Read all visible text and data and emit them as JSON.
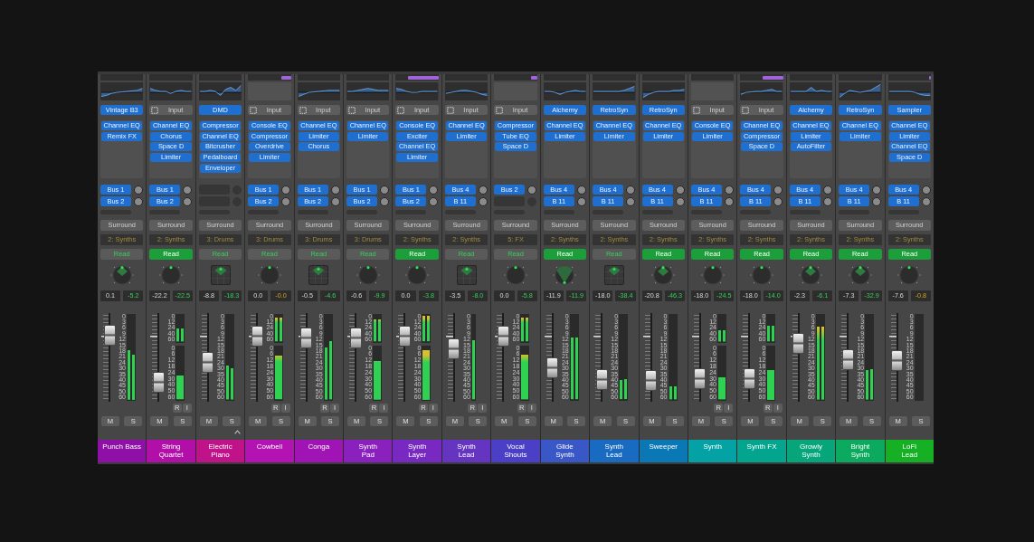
{
  "mixer": {
    "strips": [
      {
        "name": "Punch Bass",
        "color": "#8e10a6",
        "eq": {
          "kind": "curve"
        },
        "input": {
          "kind": "instrument",
          "label": "Vintage B3"
        },
        "plugins": [
          "Channel EQ",
          "Remix FX"
        ],
        "sends": [
          "Bus 1",
          "Bus 2"
        ],
        "output": "Surround",
        "group": "2: Synths",
        "automation": {
          "label": "Read",
          "active": false
        },
        "pan": {
          "kind": "wedge"
        },
        "volume": "0.1",
        "peak": {
          "text": "-5.2",
          "near_clip": false
        },
        "fader": {
          "level": 0.74
        },
        "meter": {
          "kind": "single",
          "scale": [
            "0",
            "3",
            "6",
            "9",
            "12",
            "15",
            "18",
            "21",
            "24",
            "30",
            "35",
            "40",
            "45",
            "50",
            "60"
          ],
          "bars": [
            {
              "level": 0.57
            },
            {
              "level": 0.52
            }
          ]
        },
        "mute": "M",
        "solo": "S",
        "caret": false
      },
      {
        "name": "String\nQuartet",
        "color": "#b10fa8",
        "eq": {
          "kind": "curve"
        },
        "input": {
          "kind": "input",
          "label": "Input"
        },
        "plugins": [
          "Channel EQ",
          "Chorus",
          "Space D",
          "Limiter"
        ],
        "sends": [
          "Bus 1",
          "Bus 2"
        ],
        "output": "Surround",
        "group": "2: Synths",
        "automation": {
          "label": "Read",
          "active": true
        },
        "pan": {
          "kind": "knob"
        },
        "volume": "-22.2",
        "peak": {
          "text": "-22.5",
          "near_clip": false
        },
        "fader": {
          "level": 0.21
        },
        "meter": {
          "kind": "split",
          "input_scale": [
            "0",
            "12",
            "24",
            "40",
            "60"
          ],
          "input_bars": [
            {
              "level": 0.45
            },
            {
              "level": 0.45
            }
          ],
          "scale": [
            "0",
            "6",
            "12",
            "18",
            "24",
            "30",
            "40",
            "50",
            "60"
          ],
          "bars": [
            {
              "level": 0.43
            }
          ]
        },
        "rec_buttons": [
          "R",
          "I"
        ],
        "mute": "M",
        "solo": "S",
        "caret": false
      },
      {
        "name": "Electric\nPiano",
        "color": "#c0138a",
        "eq": {
          "kind": "curve"
        },
        "input": {
          "kind": "instrument",
          "label": "DMD"
        },
        "plugins": [
          "Compressor",
          "Channel EQ",
          "Bitcrusher",
          "Pedalboard",
          "Enveloper"
        ],
        "output": "Surround",
        "group": "3: Drums",
        "automation": {
          "label": "Read",
          "active": false
        },
        "pan": {
          "kind": "square"
        },
        "volume": "-8.8",
        "peak": {
          "text": "-18.3",
          "near_clip": false
        },
        "fader": {
          "level": 0.44
        },
        "meter": {
          "kind": "single",
          "scale": [
            "0",
            "3",
            "6",
            "9",
            "12",
            "15",
            "18",
            "21",
            "24",
            "30",
            "35",
            "40",
            "45",
            "50",
            "60"
          ],
          "bars": [
            {
              "level": 0.39
            },
            {
              "level": 0.36
            }
          ]
        },
        "mute": "M",
        "solo": "S",
        "caret": true
      },
      {
        "name": "Cowbell",
        "color": "#b313b2",
        "top_bar": {
          "level": 0.22
        },
        "eq": {
          "kind": "empty"
        },
        "input": {
          "kind": "input",
          "label": "Input"
        },
        "plugins": [
          "Console EQ",
          "Compressor",
          "Overdrive",
          "Limiter"
        ],
        "sends": [
          "Bus 1",
          "Bus 2"
        ],
        "output": "Surround",
        "group": "3: Drums",
        "automation": {
          "label": "Read",
          "active": false
        },
        "pan": {
          "kind": "knob"
        },
        "volume": "0.0",
        "peak": {
          "text": "-0.0",
          "near_clip": true
        },
        "fader": {
          "level": 0.73
        },
        "meter": {
          "kind": "split",
          "input_scale": [
            "0",
            "12",
            "24",
            "40",
            "60"
          ],
          "input_bars": [
            {
              "level": 0.82
            },
            {
              "level": 0.82
            }
          ],
          "scale": [
            "0",
            "6",
            "12",
            "18",
            "24",
            "30",
            "40",
            "50",
            "60"
          ],
          "bars": [
            {
              "level": 0.79
            }
          ]
        },
        "rec_buttons": [
          "R",
          "I"
        ],
        "mute": "M",
        "solo": "S",
        "caret": false
      },
      {
        "name": "Conga",
        "color": "#a013b5",
        "eq": {
          "kind": "curve"
        },
        "input": {
          "kind": "input",
          "label": "Input"
        },
        "plugins": [
          "Channel EQ",
          "Limiter",
          "Chorus"
        ],
        "sends": [
          "Bus 1",
          "Bus 2"
        ],
        "output": "Surround",
        "group": "3: Drums",
        "automation": {
          "label": "Read",
          "active": false
        },
        "pan": {
          "kind": "square"
        },
        "volume": "-0.5",
        "peak": {
          "text": "-4.6",
          "near_clip": false
        },
        "fader": {
          "level": 0.71
        },
        "meter": {
          "kind": "single",
          "scale": [
            "0",
            "3",
            "6",
            "9",
            "12",
            "15",
            "18",
            "21",
            "24",
            "30",
            "35",
            "40",
            "45",
            "50",
            "60"
          ],
          "bars": [
            {
              "level": 0.6
            },
            {
              "level": 0.67
            }
          ]
        },
        "rec_buttons": [
          "R",
          "I"
        ],
        "mute": "M",
        "solo": "S",
        "caret": false
      },
      {
        "name": "Synth\nPad",
        "color": "#8a20be",
        "eq": {
          "kind": "curve"
        },
        "input": {
          "kind": "input",
          "label": "Input"
        },
        "plugins": [
          "Channel EQ",
          "Limiter"
        ],
        "sends": [
          "Bus 1",
          "Bus 2"
        ],
        "output": "Surround",
        "group": "3: Drums",
        "automation": {
          "label": "Read",
          "active": false
        },
        "pan": {
          "kind": "knob"
        },
        "volume": "-0.6",
        "peak": {
          "text": "-9.9",
          "near_clip": false
        },
        "fader": {
          "level": 0.71
        },
        "meter": {
          "kind": "split",
          "input_scale": [
            "0",
            "12",
            "24",
            "40",
            "60"
          ],
          "input_bars": [
            {
              "level": 0.76
            },
            {
              "level": 0.76
            }
          ],
          "scale": [
            "0",
            "6",
            "12",
            "18",
            "24",
            "30",
            "40",
            "50",
            "60"
          ],
          "bars": [
            {
              "level": 0.7
            }
          ]
        },
        "rec_buttons": [
          "R",
          "I"
        ],
        "mute": "M",
        "solo": "S",
        "caret": false
      },
      {
        "name": "Synth\nLayer",
        "color": "#7829c2",
        "top_bar": {
          "level": 0.72
        },
        "eq": {
          "kind": "curve"
        },
        "input": {
          "kind": "input",
          "label": "Input"
        },
        "plugins": [
          "Console EQ",
          "Exciter",
          "Channel EQ",
          "Limiter"
        ],
        "sends": [
          "Bus 1",
          "Bus 2"
        ],
        "output": "Surround",
        "group": "2: Synths",
        "automation": {
          "label": "Read",
          "active": true
        },
        "pan": {
          "kind": "knob"
        },
        "volume": "0.0",
        "peak": {
          "text": "-3.8",
          "near_clip": false
        },
        "fader": {
          "level": 0.73
        },
        "meter": {
          "kind": "split",
          "input_scale": [
            "0",
            "12",
            "24",
            "40",
            "60"
          ],
          "input_bars": [
            {
              "level": 0.88
            },
            {
              "level": 0.88
            }
          ],
          "scale": [
            "0",
            "6",
            "12",
            "18",
            "24",
            "30",
            "40",
            "50",
            "60"
          ],
          "bars": [
            {
              "level": 0.9
            }
          ]
        },
        "rec_buttons": [
          "R",
          "I"
        ],
        "mute": "M",
        "solo": "S",
        "caret": false
      },
      {
        "name": "Synth\nLead",
        "color": "#6534c0",
        "eq": {
          "kind": "curve"
        },
        "input": {
          "kind": "input",
          "label": "Input"
        },
        "plugins": [
          "Channel EQ",
          "Limiter"
        ],
        "sends": [
          "Bus 4",
          "B 11"
        ],
        "output": "Surround",
        "group": "2: Synths",
        "automation": {
          "label": "Read",
          "active": false
        },
        "pan": {
          "kind": "square"
        },
        "volume": "-3.5",
        "peak": {
          "text": "-8.0",
          "near_clip": false
        },
        "fader": {
          "level": 0.59
        },
        "meter": {
          "kind": "single",
          "scale": [
            "0",
            "3",
            "6",
            "9",
            "12",
            "15",
            "18",
            "21",
            "24",
            "30",
            "35",
            "40",
            "45",
            "50",
            "60"
          ],
          "bars": [
            {
              "level": 0.68
            }
          ]
        },
        "rec_buttons": [
          "R",
          "I"
        ],
        "mute": "M",
        "solo": "S",
        "caret": false
      },
      {
        "name": "Vocal\nShouts",
        "color": "#4a3fc6",
        "top_bar": {
          "level": 0.15
        },
        "eq": {
          "kind": "empty"
        },
        "input": {
          "kind": "input",
          "label": "Input"
        },
        "plugins": [
          "Compressor",
          "Tube EQ",
          "Space D"
        ],
        "sends": [
          "Bus 2"
        ],
        "output": "Surround",
        "group": "5: FX",
        "automation": {
          "label": "Read",
          "active": false
        },
        "pan": {
          "kind": "knob"
        },
        "volume": "0.0",
        "peak": {
          "text": "-5.8",
          "near_clip": false
        },
        "fader": {
          "level": 0.73
        },
        "meter": {
          "kind": "split",
          "input_scale": [
            "0",
            "12",
            "24",
            "40",
            "60"
          ],
          "input_bars": [
            {
              "level": 0.82
            },
            {
              "level": 0.82
            }
          ],
          "scale": [
            "0",
            "6",
            "12",
            "18",
            "24",
            "30",
            "40",
            "50",
            "60"
          ],
          "bars": [
            {
              "level": 0.81
            }
          ]
        },
        "rec_buttons": [
          "R",
          "I"
        ],
        "mute": "M",
        "solo": "S",
        "caret": false
      },
      {
        "name": "Glide\nSynth",
        "color": "#3a57c7",
        "eq": {
          "kind": "curve"
        },
        "input": {
          "kind": "instrument",
          "label": "Alchemy"
        },
        "plugins": [
          "Channel EQ",
          "Limiter"
        ],
        "sends": [
          "Bus 4",
          "B 11"
        ],
        "output": "Surround",
        "group": "2: Synths",
        "automation": {
          "label": "Read",
          "active": true
        },
        "pan": {
          "kind": "fan"
        },
        "volume": "-11.9",
        "peak": {
          "text": "-11.9",
          "near_clip": false
        },
        "fader": {
          "level": 0.38
        },
        "meter": {
          "kind": "single",
          "scale": [
            "0",
            "3",
            "6",
            "9",
            "12",
            "15",
            "18",
            "21",
            "24",
            "30",
            "35",
            "40",
            "45",
            "50",
            "60"
          ],
          "bars": [
            {
              "level": 0.71
            },
            {
              "level": 0.71
            }
          ]
        },
        "mute": "M",
        "solo": "S",
        "caret": false
      },
      {
        "name": "Synth\nLead",
        "color": "#196bc1",
        "eq": {
          "kind": "curve"
        },
        "input": {
          "kind": "instrument",
          "label": "RetroSyn"
        },
        "plugins": [
          "Channel EQ",
          "Limiter"
        ],
        "sends": [
          "Bus 4",
          "B 11"
        ],
        "output": "Surround",
        "group": "2: Synths",
        "automation": {
          "label": "Read",
          "active": false
        },
        "pan": {
          "kind": "square"
        },
        "volume": "-18.0",
        "peak": {
          "text": "-38.4",
          "near_clip": false
        },
        "fader": {
          "level": 0.25
        },
        "meter": {
          "kind": "single",
          "scale": [
            "0",
            "3",
            "6",
            "9",
            "12",
            "15",
            "18",
            "21",
            "24",
            "30",
            "35",
            "40",
            "45",
            "50",
            "60"
          ],
          "bars": [
            {
              "level": 0.22
            },
            {
              "level": 0.23
            }
          ]
        },
        "mute": "M",
        "solo": "S",
        "caret": false
      },
      {
        "name": "Sweeper",
        "color": "#0a78b4",
        "eq": {
          "kind": "curve"
        },
        "input": {
          "kind": "instrument",
          "label": "RetroSyn"
        },
        "plugins": [
          "Channel EQ",
          "Limiter"
        ],
        "sends": [
          "Bus 4",
          "B 11"
        ],
        "output": "Surround",
        "group": "2: Synths",
        "automation": {
          "label": "Read",
          "active": true
        },
        "pan": {
          "kind": "wedge"
        },
        "volume": "-20.8",
        "peak": {
          "text": "-46.3",
          "near_clip": false
        },
        "fader": {
          "level": 0.23
        },
        "meter": {
          "kind": "single",
          "scale": [
            "0",
            "3",
            "6",
            "9",
            "12",
            "15",
            "18",
            "21",
            "24",
            "30",
            "35",
            "40",
            "45",
            "50",
            "60"
          ],
          "bars": [
            {
              "level": 0.15
            },
            {
              "level": 0.15
            }
          ]
        },
        "mute": "M",
        "solo": "S",
        "caret": false
      },
      {
        "name": "Synth",
        "color": "#04a2a5",
        "eq": {
          "kind": "empty"
        },
        "input": {
          "kind": "input",
          "label": "Input"
        },
        "plugins": [
          "Console EQ",
          "Limiter"
        ],
        "sends": [
          "Bus 4",
          "B 11"
        ],
        "output": "Surround",
        "group": "2: Synths",
        "automation": {
          "label": "Read",
          "active": true
        },
        "pan": {
          "kind": "knob"
        },
        "volume": "-18.0",
        "peak": {
          "text": "-24.5",
          "near_clip": false
        },
        "fader": {
          "level": 0.26
        },
        "meter": {
          "kind": "split",
          "input_scale": [
            "0",
            "12",
            "24",
            "40",
            "60"
          ],
          "input_bars": [
            {
              "level": 0.39
            },
            {
              "level": 0.39
            }
          ],
          "scale": [
            "0",
            "6",
            "12",
            "18",
            "24",
            "30",
            "40",
            "50",
            "60"
          ],
          "bars": [
            {
              "level": 0.4
            }
          ]
        },
        "rec_buttons": [
          "R",
          "I"
        ],
        "mute": "M",
        "solo": "S",
        "caret": false
      },
      {
        "name": "Synth FX",
        "color": "#04a58e",
        "top_bar": {
          "level": 0.48
        },
        "eq": {
          "kind": "curve"
        },
        "input": {
          "kind": "input",
          "label": "Input"
        },
        "plugins": [
          "Channel EQ",
          "Compressor",
          "Space D"
        ],
        "sends": [
          "Bus 4",
          "B 11"
        ],
        "output": "Surround",
        "group": "2: Synths",
        "automation": {
          "label": "Read",
          "active": true
        },
        "pan": {
          "kind": "knob"
        },
        "volume": "-18.0",
        "peak": {
          "text": "-14.0",
          "near_clip": false
        },
        "fader": {
          "level": 0.26
        },
        "meter": {
          "kind": "split",
          "input_scale": [
            "0",
            "12",
            "24",
            "40",
            "60"
          ],
          "input_bars": [
            {
              "level": 0.54
            },
            {
              "level": 0.54
            }
          ],
          "scale": [
            "0",
            "6",
            "12",
            "18",
            "24",
            "30",
            "40",
            "50",
            "60"
          ],
          "bars": [
            {
              "level": 0.54
            }
          ]
        },
        "rec_buttons": [
          "R",
          "I"
        ],
        "mute": "M",
        "solo": "S",
        "caret": false
      },
      {
        "name": "Growly\nSynth",
        "color": "#06a67a",
        "eq": {
          "kind": "curve"
        },
        "input": {
          "kind": "instrument",
          "label": "Alchemy"
        },
        "plugins": [
          "Channel EQ",
          "Limiter",
          "AutoFilter"
        ],
        "sends": [
          "Bus 4",
          "B 11"
        ],
        "output": "Surround",
        "group": "2: Synths",
        "automation": {
          "label": "Read",
          "active": true
        },
        "pan": {
          "kind": "wedge"
        },
        "volume": "-2.3",
        "peak": {
          "text": "-6.1",
          "near_clip": false
        },
        "fader": {
          "level": 0.65
        },
        "meter": {
          "kind": "single",
          "scale": [
            "0",
            "3",
            "6",
            "9",
            "12",
            "15",
            "18",
            "21",
            "24",
            "30",
            "35",
            "40",
            "45",
            "50",
            "60"
          ],
          "bars": [
            {
              "level": 0.84
            },
            {
              "level": 0.84
            }
          ]
        },
        "mute": "M",
        "solo": "S",
        "caret": false
      },
      {
        "name": "Bright\nSynth",
        "color": "#0baa5e",
        "eq": {
          "kind": "curve"
        },
        "input": {
          "kind": "instrument",
          "label": "RetroSyn"
        },
        "plugins": [
          "Channel EQ",
          "Limiter"
        ],
        "sends": [
          "Bus 4",
          "B 11"
        ],
        "output": "Surround",
        "group": "2: Synths",
        "automation": {
          "label": "Read",
          "active": true
        },
        "pan": {
          "kind": "wedge"
        },
        "volume": "-7.3",
        "peak": {
          "text": "-32.9",
          "near_clip": false
        },
        "fader": {
          "level": 0.47
        },
        "meter": {
          "kind": "single",
          "scale": [
            "0",
            "3",
            "6",
            "9",
            "12",
            "15",
            "18",
            "21",
            "24",
            "30",
            "35",
            "40",
            "45",
            "50",
            "60"
          ],
          "bars": [
            {
              "level": 0.34
            },
            {
              "level": 0.35
            }
          ]
        },
        "mute": "M",
        "solo": "S",
        "caret": false
      },
      {
        "name": "LoFi\nLead",
        "color": "#15b024",
        "top_bar": {
          "level": 0.04
        },
        "eq": {
          "kind": "curve"
        },
        "input": {
          "kind": "instrument",
          "label": "Sampler"
        },
        "plugins": [
          "Channel EQ",
          "Limiter",
          "Channel EQ",
          "Space D"
        ],
        "sends": [
          "Bus 4",
          "B 11"
        ],
        "output": "Surround",
        "group": "2: Synths",
        "automation": {
          "label": "Read",
          "active": true
        },
        "pan": {
          "kind": "knob"
        },
        "volume": "-7.6",
        "peak": {
          "text": "-0.8",
          "near_clip": true
        },
        "fader": {
          "level": 0.46
        },
        "meter": {
          "kind": "single",
          "scale": [
            "0",
            "3",
            "6",
            "9",
            "12",
            "15",
            "18",
            "21",
            "24",
            "30",
            "35",
            "40",
            "45",
            "50",
            "60"
          ]
        },
        "mute": "M",
        "solo": "S",
        "caret": false
      }
    ]
  }
}
